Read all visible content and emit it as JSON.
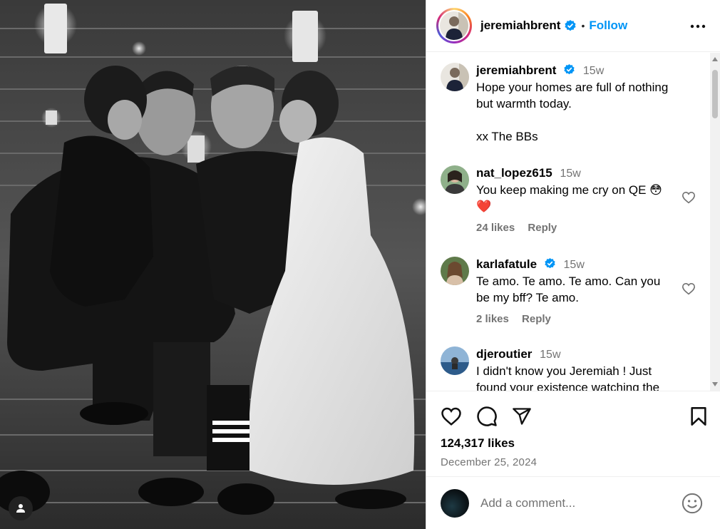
{
  "post": {
    "username": "jeremiahbrent",
    "follow_label": "Follow",
    "caption_time": "15w",
    "caption": "Hope your homes are full of nothing\nbut warmth today.\n\nxx The BBs"
  },
  "comments": [
    {
      "user": "nat_lopez615",
      "time": "15w",
      "text": "You keep making me cry on QE 😳\n❤️",
      "likes": "24 likes",
      "reply": "Reply"
    },
    {
      "user": "karlafatule",
      "time": "15w",
      "verified": true,
      "text": "Te amo. Te amo. Te amo. Can you\nbe my bff? Te amo.",
      "likes": "2 likes",
      "reply": "Reply"
    },
    {
      "user": "djeroutier",
      "time": "15w",
      "text": "I didn't know you Jeremiah ! Just\nfound your existence watching the"
    }
  ],
  "stats": {
    "likes": "124,317 likes",
    "date": "December 25, 2024"
  },
  "add_comment": {
    "placeholder": "Add a comment..."
  },
  "colors": {
    "link": "#0095f6",
    "muted": "#737373",
    "verified": "#0095f6"
  },
  "icons": [
    "tag-user-icon",
    "verified-icon",
    "more-options-icon",
    "heart-icon",
    "comment-icon",
    "share-icon",
    "bookmark-icon",
    "emoji-icon"
  ]
}
